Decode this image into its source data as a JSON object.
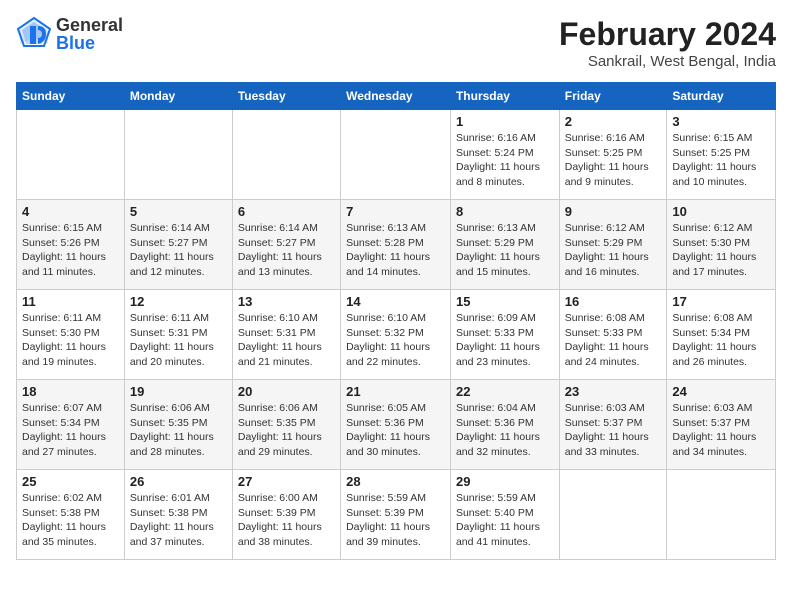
{
  "header": {
    "logo_general": "General",
    "logo_blue": "Blue",
    "month_title": "February 2024",
    "location": "Sankrail, West Bengal, India"
  },
  "columns": [
    "Sunday",
    "Monday",
    "Tuesday",
    "Wednesday",
    "Thursday",
    "Friday",
    "Saturday"
  ],
  "weeks": [
    [
      {
        "day": "",
        "sunrise": "",
        "sunset": "",
        "daylight": "",
        "empty": true
      },
      {
        "day": "",
        "sunrise": "",
        "sunset": "",
        "daylight": "",
        "empty": true
      },
      {
        "day": "",
        "sunrise": "",
        "sunset": "",
        "daylight": "",
        "empty": true
      },
      {
        "day": "",
        "sunrise": "",
        "sunset": "",
        "daylight": "",
        "empty": true
      },
      {
        "day": "1",
        "sunrise": "Sunrise: 6:16 AM",
        "sunset": "Sunset: 5:24 PM",
        "daylight": "Daylight: 11 hours and 8 minutes."
      },
      {
        "day": "2",
        "sunrise": "Sunrise: 6:16 AM",
        "sunset": "Sunset: 5:25 PM",
        "daylight": "Daylight: 11 hours and 9 minutes."
      },
      {
        "day": "3",
        "sunrise": "Sunrise: 6:15 AM",
        "sunset": "Sunset: 5:25 PM",
        "daylight": "Daylight: 11 hours and 10 minutes."
      }
    ],
    [
      {
        "day": "4",
        "sunrise": "Sunrise: 6:15 AM",
        "sunset": "Sunset: 5:26 PM",
        "daylight": "Daylight: 11 hours and 11 minutes."
      },
      {
        "day": "5",
        "sunrise": "Sunrise: 6:14 AM",
        "sunset": "Sunset: 5:27 PM",
        "daylight": "Daylight: 11 hours and 12 minutes."
      },
      {
        "day": "6",
        "sunrise": "Sunrise: 6:14 AM",
        "sunset": "Sunset: 5:27 PM",
        "daylight": "Daylight: 11 hours and 13 minutes."
      },
      {
        "day": "7",
        "sunrise": "Sunrise: 6:13 AM",
        "sunset": "Sunset: 5:28 PM",
        "daylight": "Daylight: 11 hours and 14 minutes."
      },
      {
        "day": "8",
        "sunrise": "Sunrise: 6:13 AM",
        "sunset": "Sunset: 5:29 PM",
        "daylight": "Daylight: 11 hours and 15 minutes."
      },
      {
        "day": "9",
        "sunrise": "Sunrise: 6:12 AM",
        "sunset": "Sunset: 5:29 PM",
        "daylight": "Daylight: 11 hours and 16 minutes."
      },
      {
        "day": "10",
        "sunrise": "Sunrise: 6:12 AM",
        "sunset": "Sunset: 5:30 PM",
        "daylight": "Daylight: 11 hours and 17 minutes."
      }
    ],
    [
      {
        "day": "11",
        "sunrise": "Sunrise: 6:11 AM",
        "sunset": "Sunset: 5:30 PM",
        "daylight": "Daylight: 11 hours and 19 minutes."
      },
      {
        "day": "12",
        "sunrise": "Sunrise: 6:11 AM",
        "sunset": "Sunset: 5:31 PM",
        "daylight": "Daylight: 11 hours and 20 minutes."
      },
      {
        "day": "13",
        "sunrise": "Sunrise: 6:10 AM",
        "sunset": "Sunset: 5:31 PM",
        "daylight": "Daylight: 11 hours and 21 minutes."
      },
      {
        "day": "14",
        "sunrise": "Sunrise: 6:10 AM",
        "sunset": "Sunset: 5:32 PM",
        "daylight": "Daylight: 11 hours and 22 minutes."
      },
      {
        "day": "15",
        "sunrise": "Sunrise: 6:09 AM",
        "sunset": "Sunset: 5:33 PM",
        "daylight": "Daylight: 11 hours and 23 minutes."
      },
      {
        "day": "16",
        "sunrise": "Sunrise: 6:08 AM",
        "sunset": "Sunset: 5:33 PM",
        "daylight": "Daylight: 11 hours and 24 minutes."
      },
      {
        "day": "17",
        "sunrise": "Sunrise: 6:08 AM",
        "sunset": "Sunset: 5:34 PM",
        "daylight": "Daylight: 11 hours and 26 minutes."
      }
    ],
    [
      {
        "day": "18",
        "sunrise": "Sunrise: 6:07 AM",
        "sunset": "Sunset: 5:34 PM",
        "daylight": "Daylight: 11 hours and 27 minutes."
      },
      {
        "day": "19",
        "sunrise": "Sunrise: 6:06 AM",
        "sunset": "Sunset: 5:35 PM",
        "daylight": "Daylight: 11 hours and 28 minutes."
      },
      {
        "day": "20",
        "sunrise": "Sunrise: 6:06 AM",
        "sunset": "Sunset: 5:35 PM",
        "daylight": "Daylight: 11 hours and 29 minutes."
      },
      {
        "day": "21",
        "sunrise": "Sunrise: 6:05 AM",
        "sunset": "Sunset: 5:36 PM",
        "daylight": "Daylight: 11 hours and 30 minutes."
      },
      {
        "day": "22",
        "sunrise": "Sunrise: 6:04 AM",
        "sunset": "Sunset: 5:36 PM",
        "daylight": "Daylight: 11 hours and 32 minutes."
      },
      {
        "day": "23",
        "sunrise": "Sunrise: 6:03 AM",
        "sunset": "Sunset: 5:37 PM",
        "daylight": "Daylight: 11 hours and 33 minutes."
      },
      {
        "day": "24",
        "sunrise": "Sunrise: 6:03 AM",
        "sunset": "Sunset: 5:37 PM",
        "daylight": "Daylight: 11 hours and 34 minutes."
      }
    ],
    [
      {
        "day": "25",
        "sunrise": "Sunrise: 6:02 AM",
        "sunset": "Sunset: 5:38 PM",
        "daylight": "Daylight: 11 hours and 35 minutes."
      },
      {
        "day": "26",
        "sunrise": "Sunrise: 6:01 AM",
        "sunset": "Sunset: 5:38 PM",
        "daylight": "Daylight: 11 hours and 37 minutes."
      },
      {
        "day": "27",
        "sunrise": "Sunrise: 6:00 AM",
        "sunset": "Sunset: 5:39 PM",
        "daylight": "Daylight: 11 hours and 38 minutes."
      },
      {
        "day": "28",
        "sunrise": "Sunrise: 5:59 AM",
        "sunset": "Sunset: 5:39 PM",
        "daylight": "Daylight: 11 hours and 39 minutes."
      },
      {
        "day": "29",
        "sunrise": "Sunrise: 5:59 AM",
        "sunset": "Sunset: 5:40 PM",
        "daylight": "Daylight: 11 hours and 41 minutes."
      },
      {
        "day": "",
        "sunrise": "",
        "sunset": "",
        "daylight": "",
        "empty": true
      },
      {
        "day": "",
        "sunrise": "",
        "sunset": "",
        "daylight": "",
        "empty": true
      }
    ]
  ]
}
